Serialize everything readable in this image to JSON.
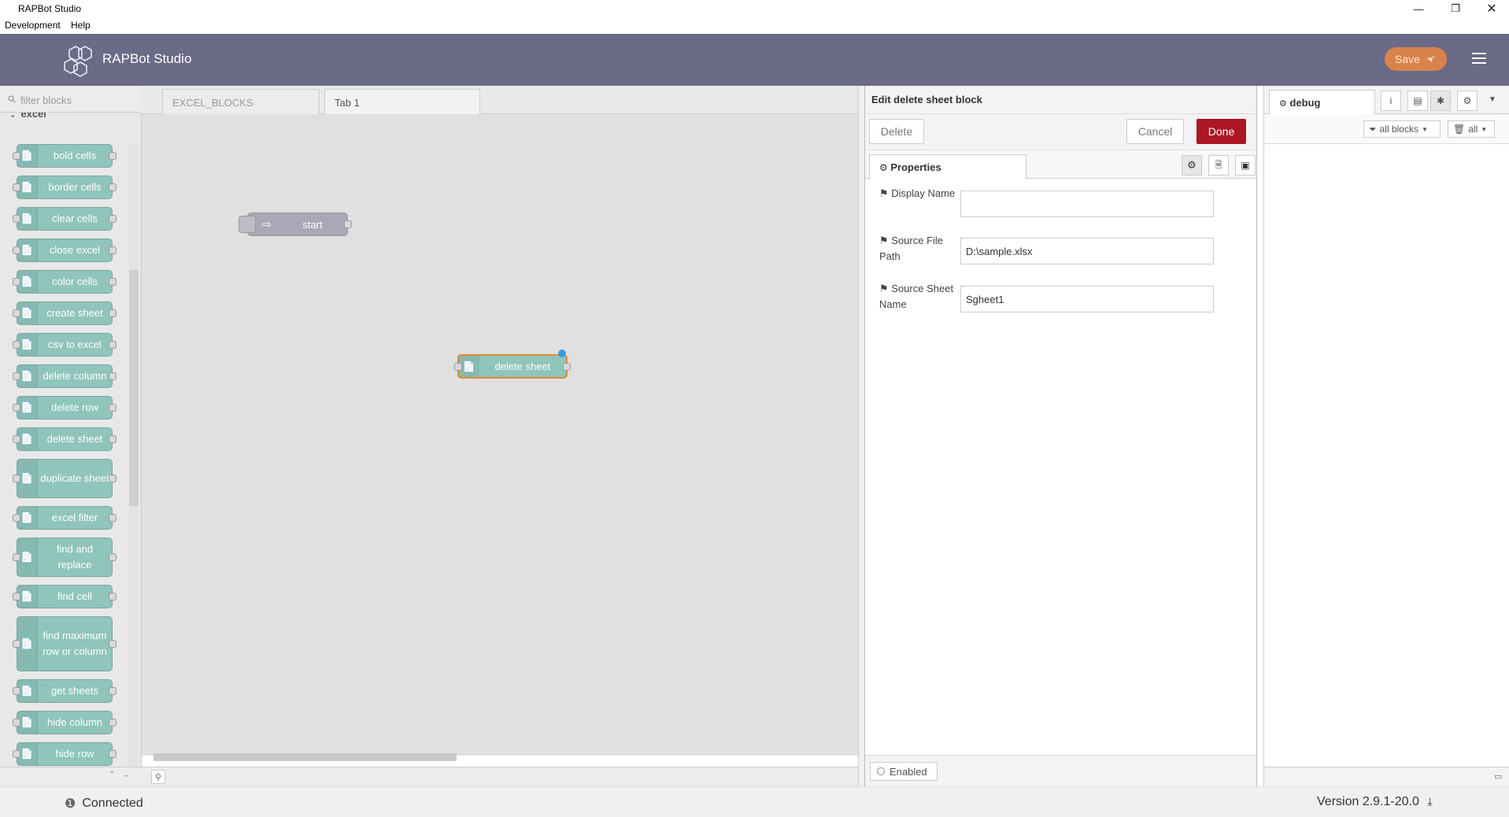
{
  "window": {
    "title": "RAPBot Studio"
  },
  "menu": {
    "items": [
      "Development",
      "Help"
    ]
  },
  "header": {
    "brand": "RAPBot Studio",
    "save_label": "Save"
  },
  "palette": {
    "filter_placeholder": "filter blocks",
    "category": "excel",
    "items": [
      "bold cells",
      "border cells",
      "clear cells",
      "close excel",
      "color cells",
      "create sheet",
      "csv to excel",
      "delete column",
      "delete row",
      "delete sheet",
      "duplicate sheet",
      "excel filter",
      "find and replace",
      "find cell",
      "find maximum row or column",
      "get sheets",
      "hide column",
      "hide row"
    ]
  },
  "workspace": {
    "tabs": [
      "EXCEL_BLOCKS",
      "Tab 1"
    ],
    "active_tab": "Tab 1",
    "nodes": {
      "start": "start",
      "delete_sheet": "delete sheet"
    }
  },
  "editor": {
    "title": "Edit delete sheet block",
    "delete_label": "Delete",
    "cancel_label": "Cancel",
    "done_label": "Done",
    "properties_tab": "Properties",
    "fields": {
      "display_name": {
        "label": "Display Name",
        "value": ""
      },
      "source_path": {
        "label": "Source File Path",
        "value": "D:\\sample.xlsx"
      },
      "sheet_name": {
        "label": "Source Sheet Name",
        "value": "Sgheet1"
      }
    },
    "enabled_label": "Enabled"
  },
  "sidebar": {
    "tab_label": "debug",
    "filter_blocks": "all blocks",
    "clear_all": "all"
  },
  "status": {
    "connection": "Connected",
    "version": "Version 2.9.1-20.0"
  },
  "colors": {
    "header": "#6b6a87",
    "save": "#d9834a",
    "done": "#ad1625",
    "node": "#8fc5bb"
  }
}
